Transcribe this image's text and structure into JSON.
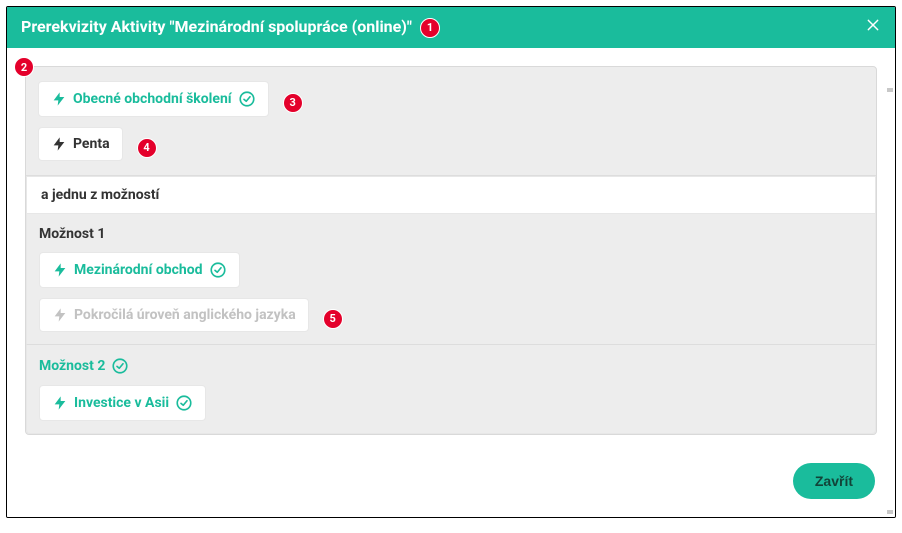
{
  "header": {
    "title": "Prerekvizity Aktivity \"Mezinárodní spolupráce (online)\""
  },
  "badges": {
    "b1": "1",
    "b2": "2",
    "b3": "3",
    "b4": "4",
    "b5": "5"
  },
  "items": {
    "general_training": "Obecné obchodní školení",
    "penta": "Penta",
    "one_of": "a jednu z možností",
    "option1_label": "Možnost 1",
    "intl_trade": "Mezinárodní obchod",
    "english_advanced": "Pokročilá úroveň anglického jazyka",
    "option2_label": "Možnost 2",
    "invest_asia": "Investice v Asii"
  },
  "footer": {
    "close": "Zavřít"
  }
}
